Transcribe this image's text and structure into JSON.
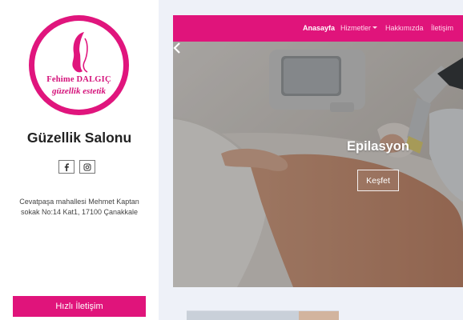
{
  "sidebar": {
    "logo": {
      "line1": "Fehime DALGIÇ",
      "line2": "güzellik estetik",
      "icon": "woman-silhouette-icon"
    },
    "salon_name": "Güzellik Salonu",
    "social": [
      {
        "name": "facebook-icon",
        "glyph": "f"
      },
      {
        "name": "instagram-icon",
        "glyph": "ig"
      }
    ],
    "address_line1": "Cevatpaşa mahallesi Mehmet Kaptan",
    "address_line2": "sokak No:14 Kat1, 17100 Çanakkale",
    "contact_button": "Hızlı İletişim"
  },
  "nav": {
    "items": [
      {
        "label": "Anasayfa",
        "active": true
      },
      {
        "label": "Hizmetler",
        "dropdown": true
      },
      {
        "label": "Hakkımızda"
      },
      {
        "label": "İletişim"
      }
    ]
  },
  "hero": {
    "title": "Epilasyon",
    "button": "Keşfet",
    "prev_icon": "chevron-left-icon"
  },
  "colors": {
    "brand": "#e0147b",
    "page_bg": "#eef1f8"
  }
}
